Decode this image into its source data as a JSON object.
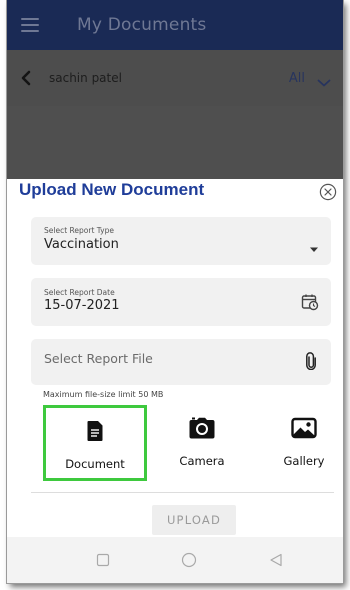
{
  "app_bar": {
    "title": "My Documents",
    "menu_icon": "hamburger-menu-icon"
  },
  "filter_bar": {
    "back_icon": "chevron-left-icon",
    "patient_name": "sachin patel",
    "filter_value": "All",
    "filter_icon": "chevron-down-icon"
  },
  "sheet": {
    "title": "Upload New Document",
    "close_icon": "close-circle-icon",
    "report_type": {
      "label": "Select Report Type",
      "value": "Vaccination",
      "icon": "dropdown-arrow-icon"
    },
    "report_date": {
      "label": "Select Report Date",
      "value": "15-07-2021",
      "icon": "calendar-clock-icon"
    },
    "report_file": {
      "placeholder": "Select Report File",
      "icon": "paperclip-icon"
    },
    "size_hint": "Maximum file-size limit 50 MB",
    "options": [
      {
        "label": "Document",
        "icon": "document-icon",
        "selected": true
      },
      {
        "label": "Camera",
        "icon": "camera-icon",
        "selected": false
      },
      {
        "label": "Gallery",
        "icon": "gallery-icon",
        "selected": false
      }
    ],
    "upload_label": "UPLOAD"
  },
  "system_nav": {
    "recents_icon": "square-icon",
    "home_icon": "circle-icon",
    "back_icon": "triangle-back-icon"
  },
  "colors": {
    "app_bar_bg": "#1a2a55",
    "sheet_title": "#1f3d99",
    "selected_border": "#3ec93e",
    "scrim": "#4d4d4d"
  }
}
